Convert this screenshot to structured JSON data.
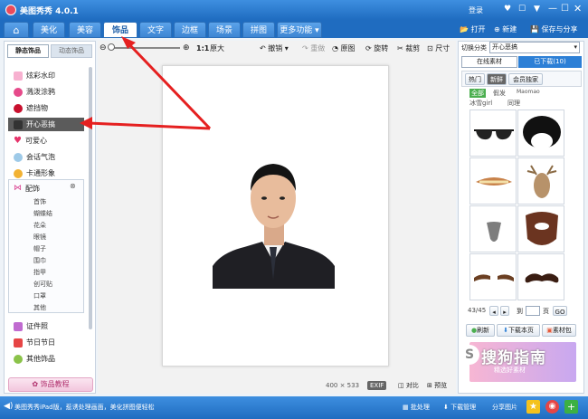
{
  "app": {
    "title": "美图秀秀 4.0.1",
    "login": "登录"
  },
  "tabs": [
    {
      "label": "美化"
    },
    {
      "label": "美容"
    },
    {
      "label": "饰品"
    },
    {
      "label": "文字"
    },
    {
      "label": "边框"
    },
    {
      "label": "场景"
    },
    {
      "label": "拼图"
    },
    {
      "label": "更多功能"
    }
  ],
  "toolbar_right": {
    "open": "打开",
    "new": "新建",
    "save": "保存与分享"
  },
  "subtabs": {
    "static": "静态饰品",
    "dynamic": "动态饰品"
  },
  "sidebar": {
    "items": [
      {
        "label": "炫彩水印"
      },
      {
        "label": "溅泼涂鸦"
      },
      {
        "label": "遮挡物"
      },
      {
        "label": "开心恶搞"
      },
      {
        "label": "可爱心"
      },
      {
        "label": "会话气泡"
      },
      {
        "label": "卡通形象"
      },
      {
        "label": "配饰"
      }
    ],
    "subitems": [
      {
        "label": "首饰"
      },
      {
        "label": "蝴蝶结"
      },
      {
        "label": "花朵"
      },
      {
        "label": "眼镜"
      },
      {
        "label": "帽子"
      },
      {
        "label": "围巾"
      },
      {
        "label": "指甲"
      },
      {
        "label": "创可贴"
      },
      {
        "label": "口罩"
      },
      {
        "label": "其他"
      }
    ],
    "bottom_items": [
      {
        "label": "证件照"
      },
      {
        "label": "节日节日"
      },
      {
        "label": "其他饰品"
      }
    ],
    "tutorial": "饰品教程"
  },
  "canvas_tools": {
    "zoom_ratio": "1:1",
    "original": "原大",
    "undo": "撤销",
    "redo": "重做",
    "reset": "原图",
    "rotate": "旋转",
    "crop": "裁剪",
    "size": "尺寸"
  },
  "canvas_bottom": {
    "dimensions": "400 × 533",
    "exif": "EXIF",
    "compare": "对比",
    "preview": "预览"
  },
  "right_panel": {
    "category_label": "切换分类",
    "category_value": "开心恶搞",
    "tab_online": "在线素材",
    "tab_downloaded": "已下载(10)",
    "filters": [
      "热门",
      "新鲜",
      "会员独家"
    ],
    "tags": [
      "全部",
      "假发",
      "Maomao",
      "冰雪girl",
      "同理"
    ],
    "page_info": "43/45",
    "goto": "到",
    "page_unit": "页",
    "go": "GO",
    "refresh": "刷新",
    "download_page": "下载本页",
    "library": "素材包"
  },
  "status": {
    "message": "美图秀秀iPad版，惹诱处理画面，美化拼图便轻松",
    "batch": "批处理",
    "download_mgr": "下载管理",
    "share": "分享图片"
  },
  "watermark": {
    "text": "搜狗指南",
    "sub": "精选好素材"
  },
  "colors": {
    "accent": "#1f6cc0",
    "arrow": "#e52020"
  }
}
